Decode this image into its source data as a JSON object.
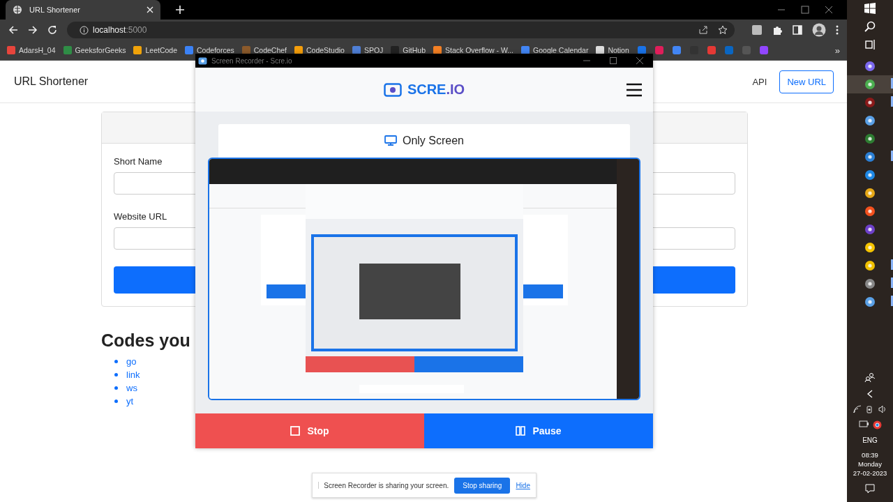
{
  "browser": {
    "tab_title": "URL Shortener",
    "url_host": "localhost",
    "url_port": ":5000",
    "bookmarks": [
      "AdarsH_04",
      "GeeksforGeeks",
      "LeetCode",
      "Codeforces",
      "CodeChef",
      "CodeStudio",
      "SPOJ",
      "GitHub",
      "Stack Overflow - W...",
      "Google Calendar",
      "Notion"
    ],
    "more": "»"
  },
  "page": {
    "brand": "URL Shortener",
    "nav": [
      {
        "label": "API",
        "kind": "link"
      },
      {
        "label": "New URL",
        "kind": "button"
      }
    ],
    "fields": [
      {
        "label": "Short Name"
      },
      {
        "label": "Website URL"
      }
    ],
    "heading": "Codes you",
    "codes": [
      "go",
      "link",
      "ws",
      "yt"
    ]
  },
  "recorder": {
    "title": "Screen Recorder - Scre.io",
    "logo_main": "SCRE",
    "logo_suffix": ".IO",
    "mode": "Only Screen",
    "buttons": [
      {
        "label": "Stop",
        "kind": "stop"
      },
      {
        "label": "Pause",
        "kind": "pause"
      }
    ]
  },
  "share_bar": {
    "message": "Screen Recorder is sharing your screen.",
    "button": "Stop sharing",
    "link": "Hide"
  },
  "taskbar": {
    "apps": [
      {
        "selected": false,
        "running": false
      },
      {
        "selected": true,
        "running": true
      },
      {
        "selected": false,
        "running": true
      },
      {
        "selected": false,
        "running": false
      },
      {
        "selected": false,
        "running": false
      },
      {
        "selected": false,
        "running": true
      },
      {
        "selected": false,
        "running": false
      },
      {
        "selected": false,
        "running": false
      },
      {
        "selected": false,
        "running": false
      },
      {
        "selected": false,
        "running": false
      },
      {
        "selected": false,
        "running": false
      },
      {
        "selected": false,
        "running": true
      },
      {
        "selected": false,
        "running": true
      },
      {
        "selected": false,
        "running": true
      }
    ],
    "language": "ENG",
    "time": "08:39",
    "day": "Monday",
    "date": "27-02-2023"
  }
}
